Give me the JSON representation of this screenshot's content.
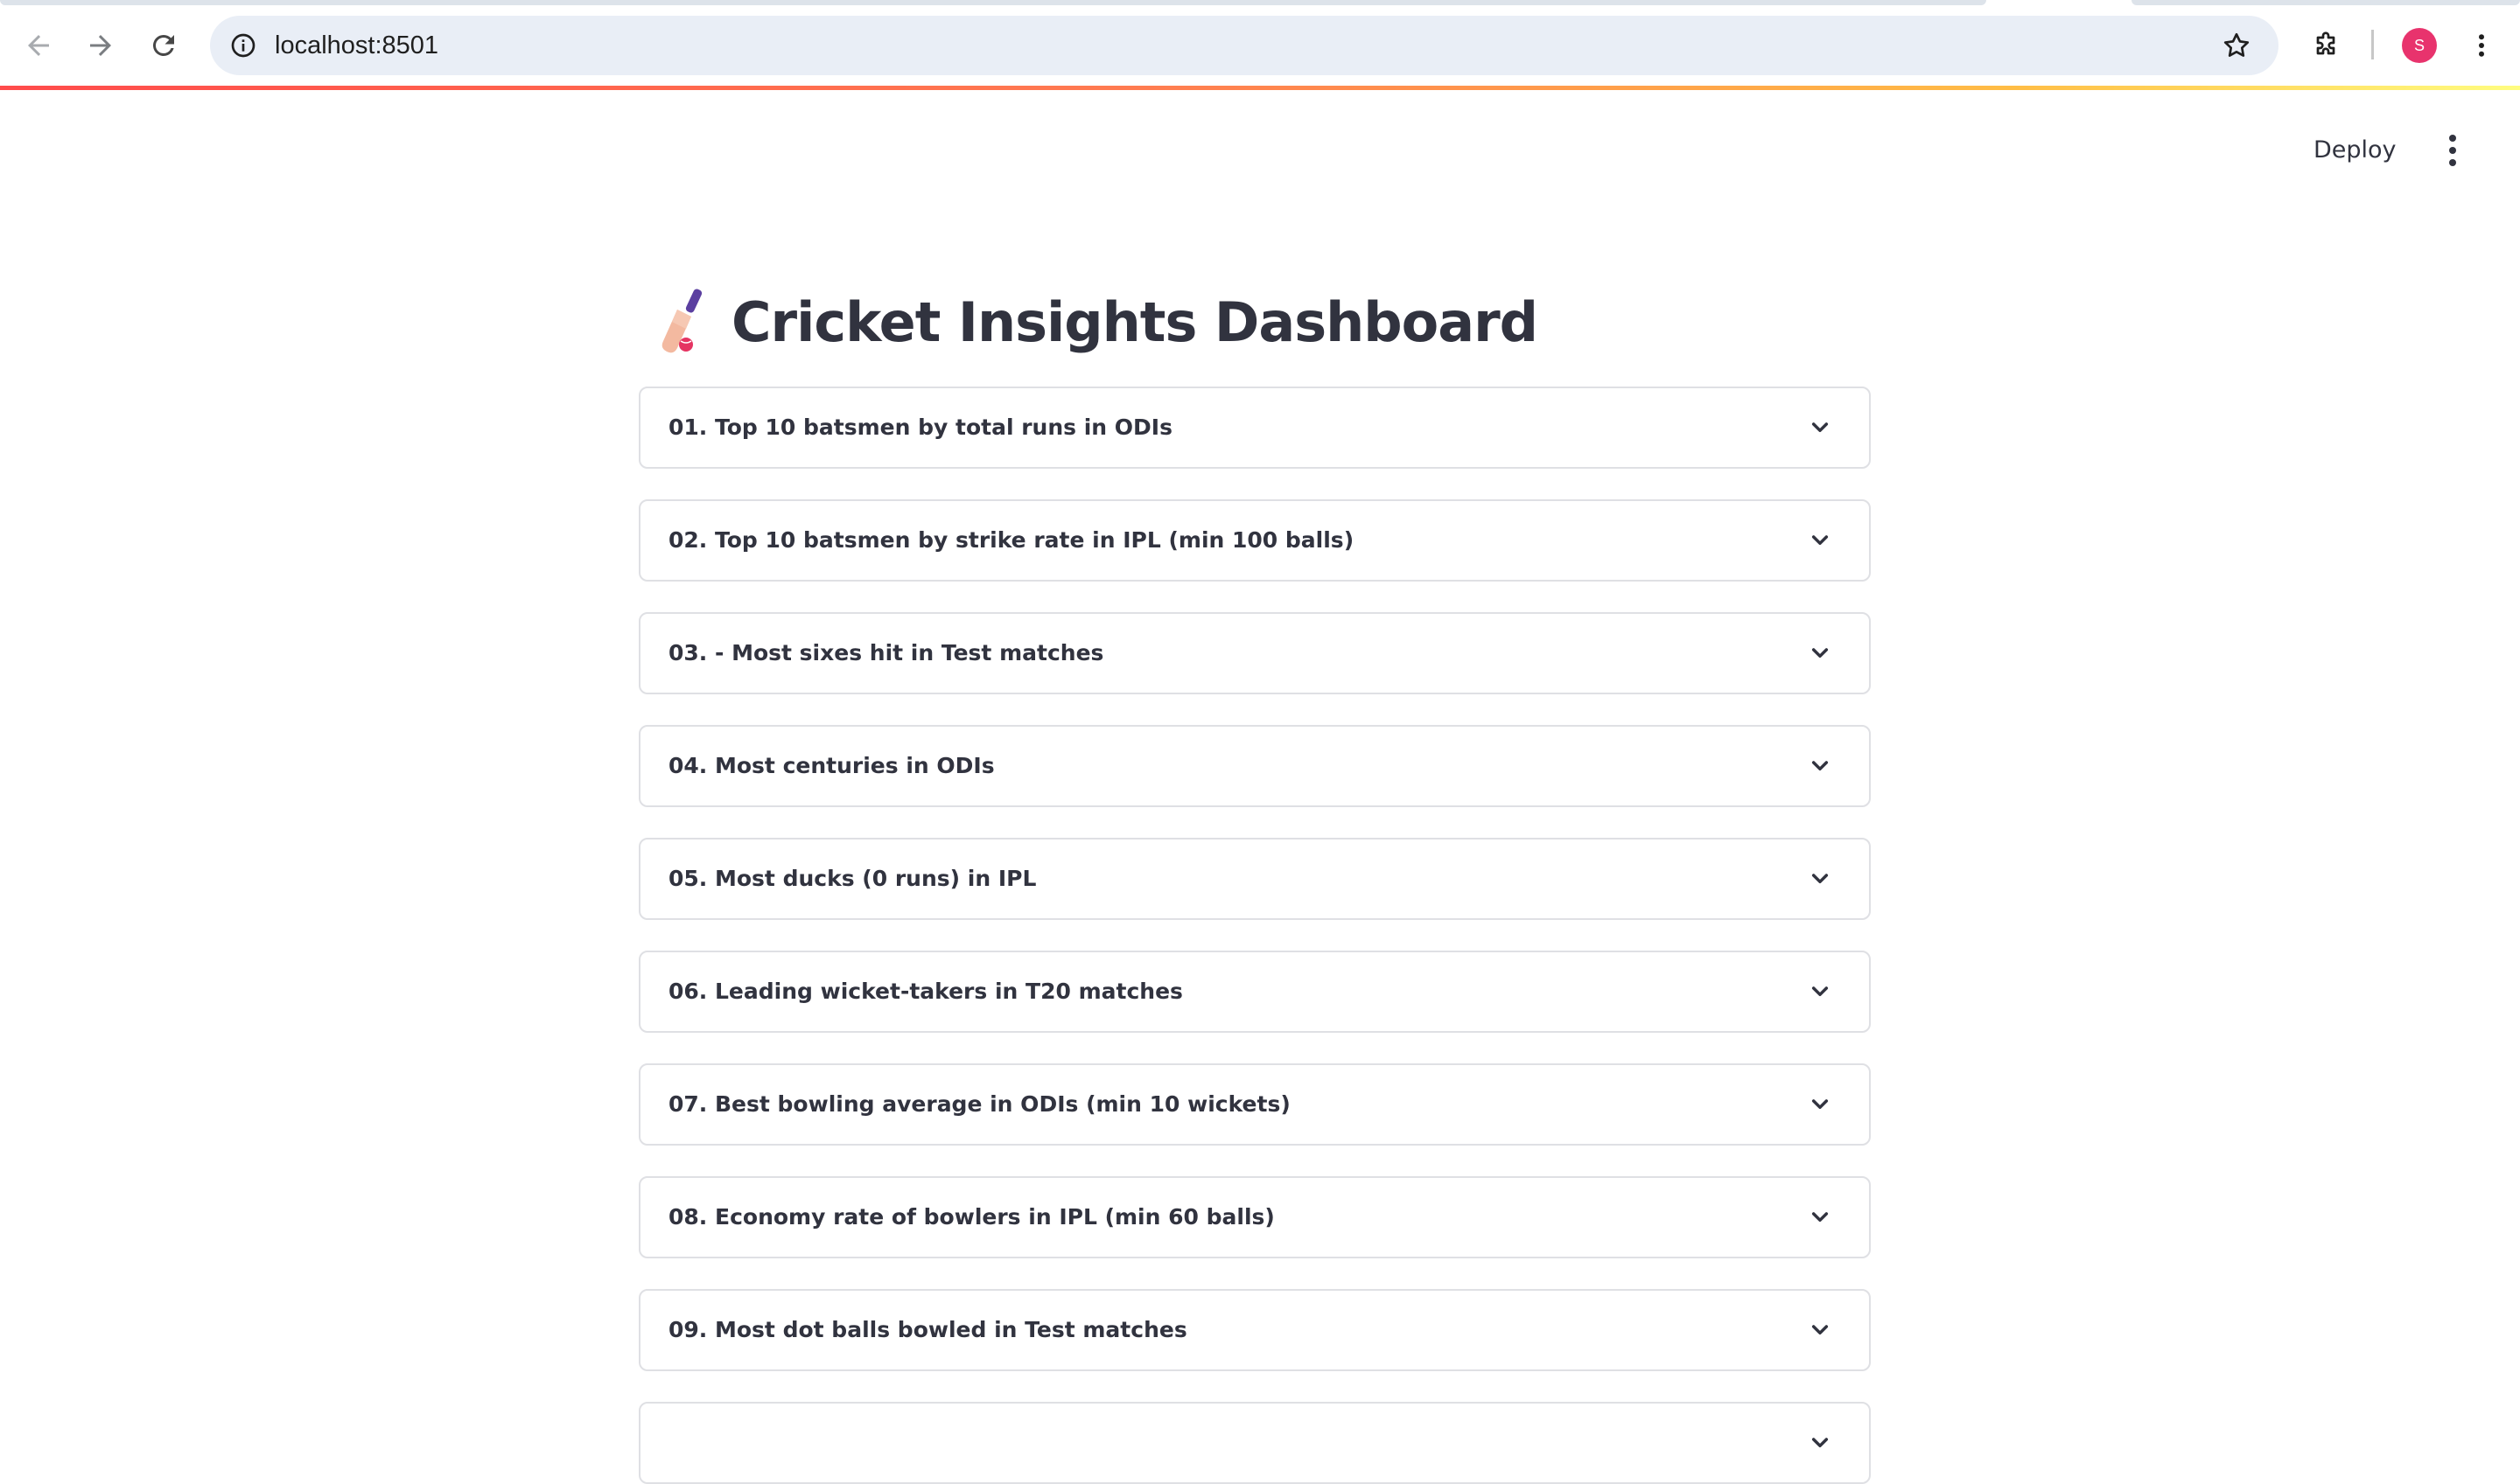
{
  "browser": {
    "url": "localhost:8501",
    "profile_initial": "S",
    "profile_color": "#e8336d",
    "icons": [
      "back-arrow-icon",
      "forward-arrow-icon",
      "reload-icon",
      "site-info-icon",
      "bookmark-star-icon",
      "extensions-icon",
      "browser-menu-icon"
    ]
  },
  "header": {
    "deploy_label": "Deploy",
    "menu_icon": "kebab-menu-icon",
    "accent_gradient": [
      "#ff4b4b",
      "#ffbd45",
      "#fffd80"
    ]
  },
  "main": {
    "title": "Cricket Insights Dashboard",
    "title_icon": "cricket-bat-icon",
    "expanders": [
      {
        "label": "01. Top 10 batsmen by total runs in ODIs"
      },
      {
        "label": "02. Top 10 batsmen by strike rate in IPL (min 100 balls)"
      },
      {
        "label": "03. - Most sixes hit in Test matches"
      },
      {
        "label": "04. Most centuries in ODIs"
      },
      {
        "label": "05. Most ducks (0 runs) in IPL"
      },
      {
        "label": "06. Leading wicket-takers in T20 matches"
      },
      {
        "label": "07. Best bowling average in ODIs (min 10 wickets)"
      },
      {
        "label": "08. Economy rate of bowlers in IPL (min 60 balls)"
      },
      {
        "label": "09. Most dot balls bowled in Test matches"
      },
      {
        "label": ""
      }
    ]
  }
}
